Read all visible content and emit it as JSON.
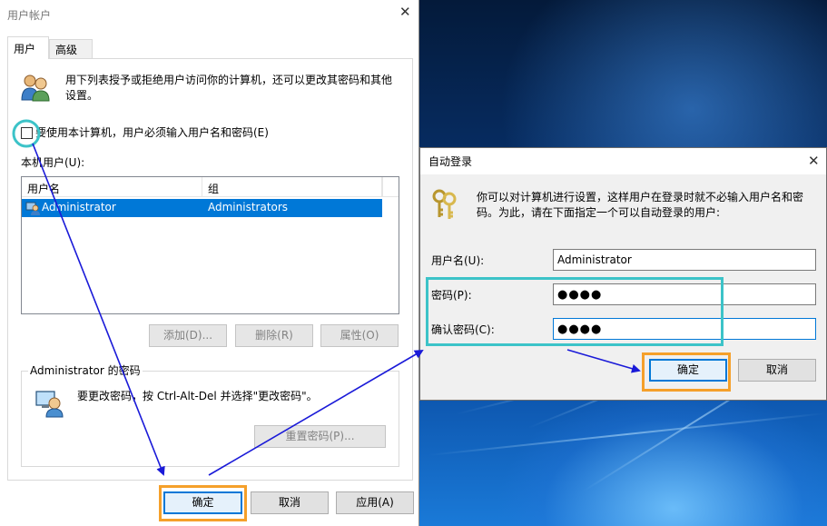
{
  "user_accounts": {
    "title": "用户帐户",
    "tabs": [
      {
        "label": "用户",
        "active": true
      },
      {
        "label": "高级",
        "active": false
      }
    ],
    "intro_line1": "用下列表授予或拒绝用户访问你的计算机，还可以更改其密码和其他",
    "intro_line2": "设置。",
    "require_password_checkbox": {
      "label": "要使用本计算机，用户必须输入用户名和密码(E)",
      "checked": false
    },
    "local_users_label": "本机用户(U):",
    "table": {
      "columns": [
        "用户名",
        "组"
      ],
      "rows": [
        {
          "username": "Administrator",
          "group": "Administrators",
          "selected": true
        }
      ]
    },
    "buttons": {
      "add": "添加(D)...",
      "remove": "删除(R)",
      "properties": "属性(O)"
    },
    "password_group": {
      "label": "Administrator 的密码",
      "text": "要更改密码，按 Ctrl-Alt-Del 并选择\"更改密码\"。",
      "reset_button": "重置密码(P)..."
    },
    "footer": {
      "ok": "确定",
      "cancel": "取消",
      "apply": "应用(A)"
    }
  },
  "auto_login": {
    "title": "自动登录",
    "desc_line1": "你可以对计算机进行设置，这样用户在登录时就不必输入用户名和密",
    "desc_line2": "码。为此，请在下面指定一个可以自动登录的用户:",
    "username_label": "用户名(U):",
    "username_value": "Administrator",
    "password_label": "密码(P):",
    "password_value": "●●●●",
    "confirm_label": "确认密码(C):",
    "confirm_value": "●●●●",
    "ok": "确定",
    "cancel": "取消"
  },
  "colors": {
    "selection": "#0078d7",
    "highlight_orange": "#f5a02a",
    "highlight_teal": "#3cc3c8",
    "arrow": "#1a1ad8"
  }
}
